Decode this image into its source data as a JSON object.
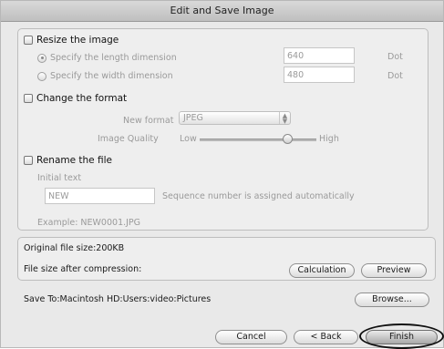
{
  "window": {
    "title": "Edit and Save Image"
  },
  "resize": {
    "label": "Resize the image",
    "length_label": "Specify the length dimension",
    "length_value": "640",
    "width_label": "Specify the width dimension",
    "width_value": "480",
    "unit": "Dot"
  },
  "format": {
    "label": "Change the format",
    "new_format_label": "New format",
    "new_format_value": "JPEG",
    "quality_label": "Image Quality",
    "quality_low": "Low",
    "quality_high": "High",
    "quality_level_fraction": 0.75
  },
  "rename": {
    "label": "Rename the file",
    "initial_text_label": "Initial text",
    "initial_text_value": "NEW",
    "sequence_note": "Sequence number is assigned automatically",
    "example": "Example:  NEW0001.JPG"
  },
  "sizes": {
    "original": "Original file size:200KB",
    "after_compression": "File size after compression:",
    "calculation_button": "Calculation",
    "preview_button": "Preview"
  },
  "save": {
    "save_to": "Save To:Macintosh HD:Users:video:Pictures",
    "browse_button": "Browse..."
  },
  "footer": {
    "cancel_button": "Cancel",
    "back_button": "< Back",
    "finish_button": "Finish"
  }
}
